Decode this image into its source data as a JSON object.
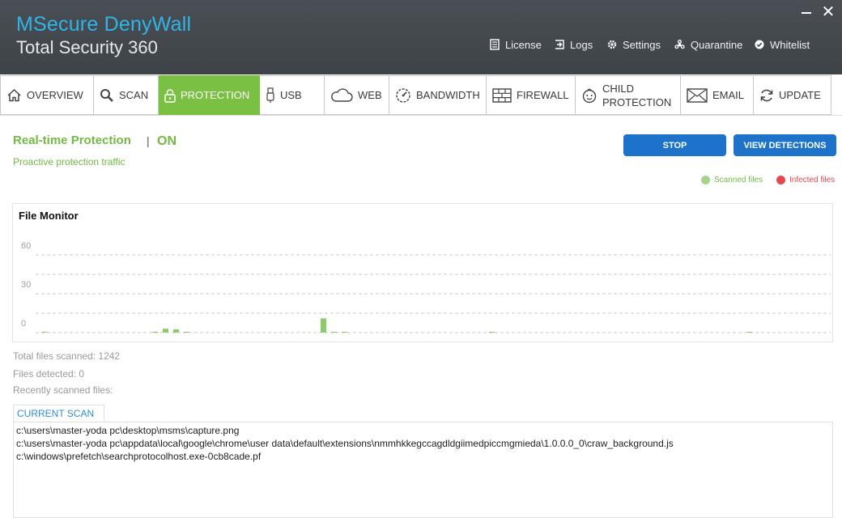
{
  "app": {
    "title_line1": "MSecure DenyWall",
    "title_line2": "Total Security 360"
  },
  "window_controls": {
    "minimize": "—",
    "close": "✕"
  },
  "top_links": [
    {
      "label": "License",
      "icon": "license-icon"
    },
    {
      "label": "Logs",
      "icon": "logs-icon"
    },
    {
      "label": "Settings",
      "icon": "gear-icon"
    },
    {
      "label": "Quarantine",
      "icon": "quarantine-icon"
    },
    {
      "label": "Whitelist",
      "icon": "check-circle-icon"
    }
  ],
  "tabs": [
    {
      "label": "OVERVIEW",
      "icon": "home-icon"
    },
    {
      "label": "SCAN",
      "icon": "search-icon"
    },
    {
      "label": "PROTECTION",
      "icon": "lock-icon",
      "active": true
    },
    {
      "label": "USB",
      "icon": "usb-icon"
    },
    {
      "label": "WEB",
      "icon": "cloud-icon"
    },
    {
      "label": "BANDWIDTH",
      "icon": "gauge-icon"
    },
    {
      "label": "FIREWALL",
      "icon": "brick-wall-icon"
    },
    {
      "label_line1": "CHILD",
      "label_line2": "PROTECTION",
      "icon": "child-face-icon"
    },
    {
      "label": "EMAIL",
      "icon": "envelope-icon"
    },
    {
      "label": "UPDATE",
      "icon": "refresh-icon"
    }
  ],
  "protection": {
    "title": "Real-time Protection",
    "separator": "|",
    "status": "ON",
    "subtitle": "Proactive protection traffic",
    "stop_label": "STOP",
    "view_detections_label": "VIEW DETECTIONS"
  },
  "legend": [
    {
      "label": "Scanned files",
      "color": "#a8d38a",
      "text_color": "#73b944"
    },
    {
      "label": "Infected files",
      "color": "#e8474d",
      "text_color": "#e8474d"
    }
  ],
  "chart_data": {
    "type": "bar",
    "title": "File Monitor",
    "ytick_labels": [
      "60",
      "30",
      "0"
    ],
    "ylim": [
      0,
      60
    ],
    "grid": true,
    "series": [
      {
        "name": "Scanned files",
        "color": "#8ccb6a",
        "points": [
          {
            "x": 3,
            "v": 0.5
          },
          {
            "x": 24,
            "v": 0.5
          },
          {
            "x": 26,
            "v": 3
          },
          {
            "x": 28,
            "v": 2.5
          },
          {
            "x": 30,
            "v": 0.5
          },
          {
            "x": 56,
            "v": 11
          },
          {
            "x": 58,
            "v": 0.6
          },
          {
            "x": 60,
            "v": 0.5
          },
          {
            "x": 88,
            "v": 0.5
          },
          {
            "x": 137,
            "v": 0.6
          }
        ]
      }
    ]
  },
  "stats": {
    "total_scanned": "Total files scanned: 1242",
    "detected": "Files detected: 0",
    "recent": "Recently scanned files:"
  },
  "current_scan": {
    "tab_label": "CURRENT SCAN",
    "lines": [
      "c:\\users\\master-yoda pc\\desktop\\msms\\capture.png",
      "c:\\users\\master-yoda pc\\appdata\\local\\google\\chrome\\user data\\default\\extensions\\nmmhkkegccagdldgiimedpiccmgmieda\\1.0.0.0_0\\craw_background.js",
      "c:\\windows\\prefetch\\searchprotocolhost.exe-0cb8cade.pf"
    ]
  }
}
